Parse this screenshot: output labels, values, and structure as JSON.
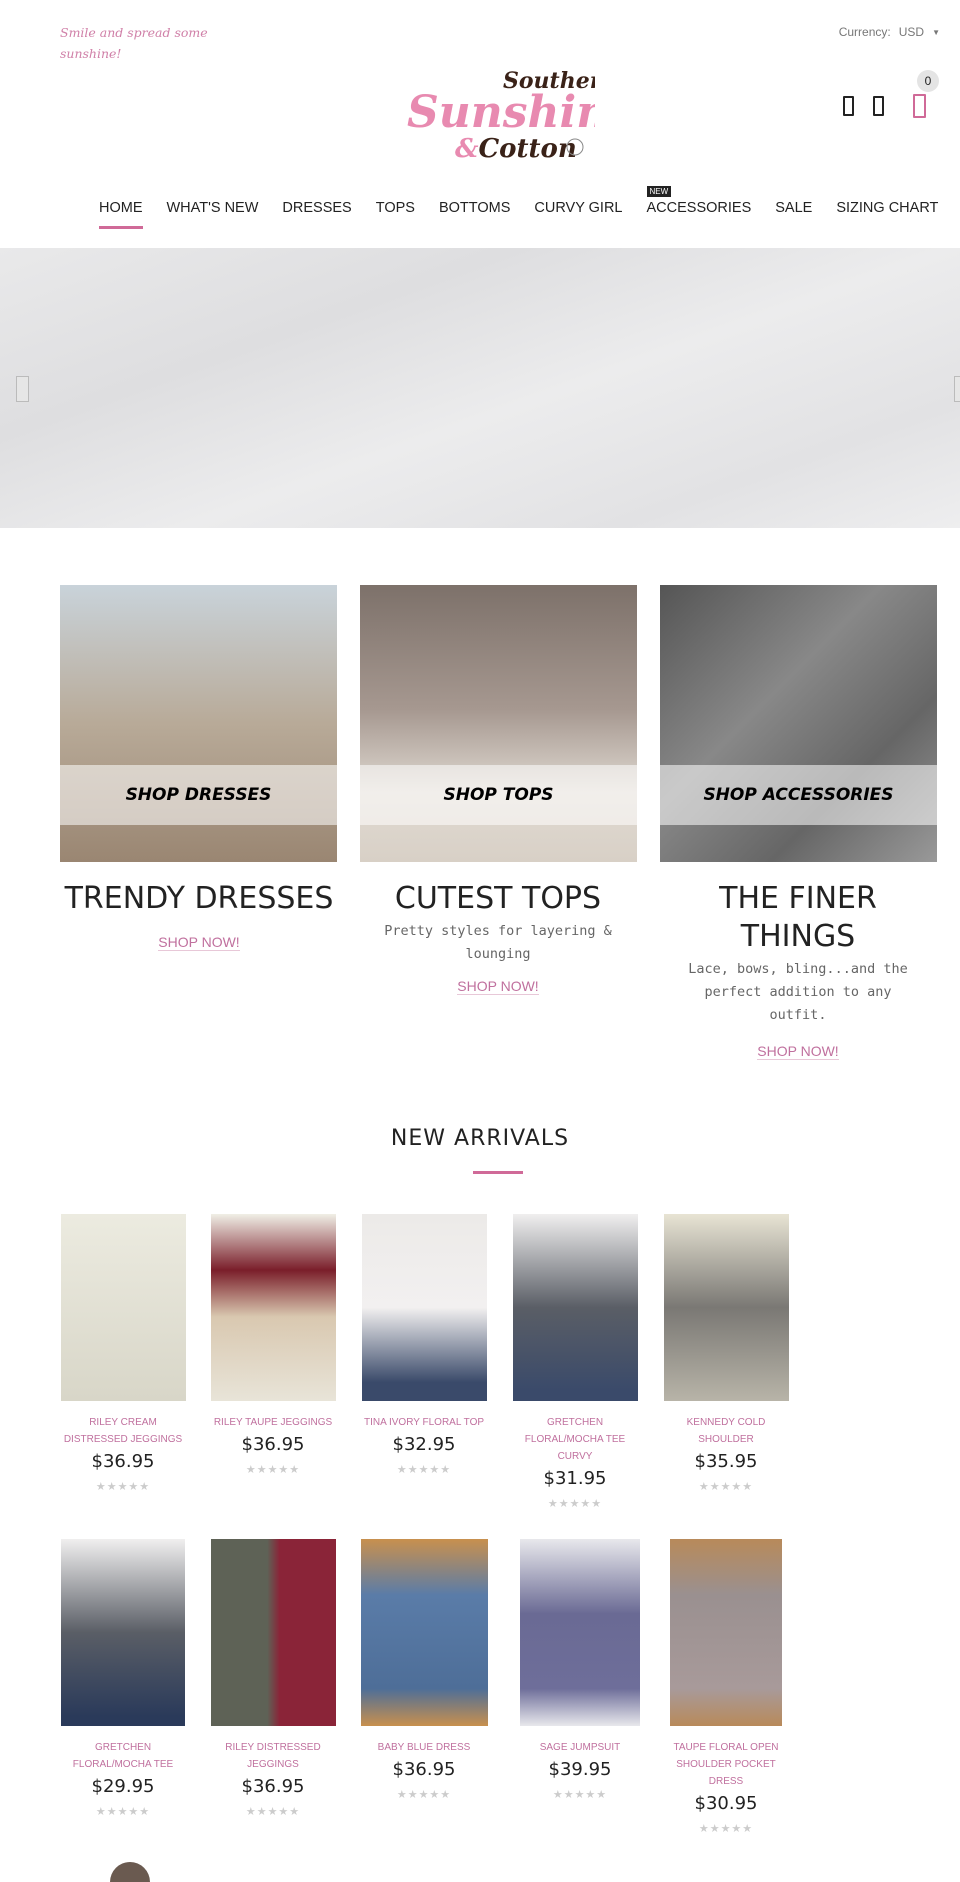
{
  "header": {
    "tagline": "Smile and spread some sunshine!",
    "currency_label": "Currency:",
    "currency_value": "USD",
    "cart_count": "0",
    "logo_text": "Southern Sunshine & Cotton",
    "icons": [
      "search-icon",
      "user-icon",
      "cart-icon"
    ]
  },
  "nav": {
    "items": [
      {
        "label": "HOME",
        "active": true
      },
      {
        "label": "WHAT'S NEW"
      },
      {
        "label": "DRESSES"
      },
      {
        "label": "TOPS"
      },
      {
        "label": "BOTTOMS"
      },
      {
        "label": "CURVY GIRL"
      },
      {
        "label": "ACCESSORIES",
        "tag": "NEW"
      },
      {
        "label": "SALE"
      },
      {
        "label": "SIZING CHART"
      }
    ]
  },
  "categories": [
    {
      "banner": "SHOP DRESSES",
      "title": "TRENDY DRESSES",
      "subtitle": "",
      "cta": "SHOP NOW!"
    },
    {
      "banner": "SHOP TOPS",
      "title": "CUTEST TOPS",
      "subtitle": "Pretty styles for layering & lounging",
      "cta": "SHOP NOW!"
    },
    {
      "banner": "SHOP ACCESSORIES",
      "title": "THE FINER THINGS",
      "subtitle": "Lace, bows, bling...and the perfect addition to any outfit.",
      "cta": "SHOP NOW!"
    }
  ],
  "new_arrivals": {
    "title": "NEW ARRIVALS",
    "products": [
      {
        "name": "Riley Cream Distressed Jeggings",
        "price": "$36.95",
        "rating": 0
      },
      {
        "name": "Riley Taupe Jeggings",
        "price": "$36.95",
        "rating": 0
      },
      {
        "name": "Tina Ivory Floral Top",
        "price": "$32.95",
        "rating": 0
      },
      {
        "name": "Gretchen Floral/Mocha Tee Curvy",
        "price": "$31.95",
        "rating": 0
      },
      {
        "name": "Kennedy Cold Shoulder",
        "price": "$35.95",
        "rating": 0
      },
      {
        "name": "Gretchen Floral/Mocha Tee",
        "price": "$29.95",
        "rating": 0
      },
      {
        "name": "Riley Distressed Jeggings",
        "price": "$36.95",
        "rating": 0
      },
      {
        "name": "Baby Blue Dress",
        "price": "$36.95",
        "rating": 0
      },
      {
        "name": "Sage Jumpsuit",
        "price": "$39.95",
        "rating": 0
      },
      {
        "name": "Taupe Floral Open Shoulder Pocket Dress",
        "price": "$30.95",
        "rating": 0
      }
    ]
  },
  "colors": {
    "accent": "#d06a98",
    "link": "#c0709e"
  }
}
